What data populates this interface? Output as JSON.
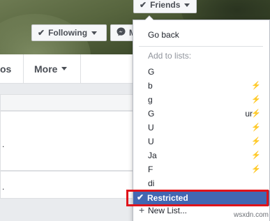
{
  "cover": {
    "friends_button": {
      "icon": "check-icon",
      "label": "Friends"
    },
    "following_button": {
      "icon": "check-icon",
      "label": "Following"
    },
    "message_button": {
      "icon": "messenger-icon",
      "label": "M"
    }
  },
  "nav": {
    "photos_partial": "os",
    "more_label": "More"
  },
  "content": {
    "card2_text": ".",
    "card3_text": "."
  },
  "friends_menu": {
    "go_back": "Go back",
    "section_label": "Add to lists:",
    "lists": [
      {
        "label": "G",
        "bolt": false,
        "suffix": ""
      },
      {
        "label": "b",
        "bolt": true,
        "suffix": ""
      },
      {
        "label": "g",
        "bolt": true,
        "suffix": ""
      },
      {
        "label": "G",
        "bolt": true,
        "suffix": "ur"
      },
      {
        "label": "U",
        "bolt": true,
        "suffix": ""
      },
      {
        "label": "U",
        "bolt": true,
        "suffix": ""
      },
      {
        "label": "Ja",
        "bolt": true,
        "suffix": ""
      },
      {
        "label": "F",
        "bolt": true,
        "suffix": ""
      },
      {
        "label": "di",
        "bolt": false,
        "suffix": ""
      }
    ],
    "restricted": {
      "label": "Restricted",
      "checked": true
    },
    "new_list": "New List..."
  },
  "watermark": "wsxdn.com",
  "colors": {
    "accent": "#4267b2",
    "highlight_border": "#e0131a"
  }
}
